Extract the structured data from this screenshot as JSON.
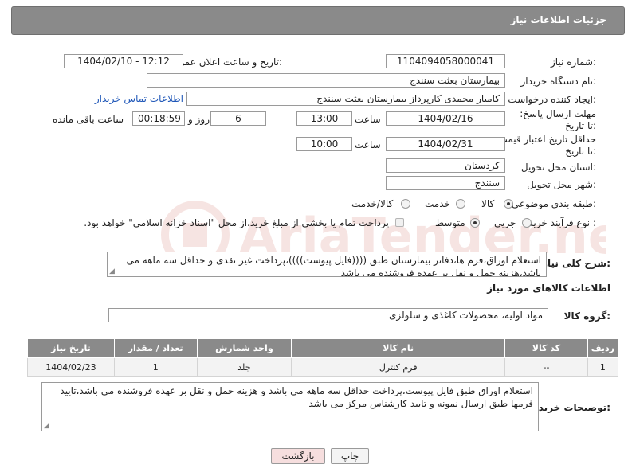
{
  "header": {
    "title": "جزئیات اطلاعات نیاز"
  },
  "fields": {
    "need_number_label": "شماره نیاز:",
    "need_number": "1104094058000041",
    "announce_label": "تاریخ و ساعت اعلان عمومی:",
    "announce_value": "1404/02/10 - 12:12",
    "buyer_org_label": "نام دستگاه خریدار:",
    "buyer_org": "بیمارستان بعثت سنندج",
    "requester_label": "ایجاد کننده درخواست:",
    "requester": "کامیار محمدی کارپرداز بیمارستان بعثت سنندج",
    "contact_link": "اطلاعات تماس خریدار",
    "deadline_label": "مهلت ارسال پاسخ: تا تاریخ:",
    "deadline_date": "1404/02/16",
    "time_label": "ساعت",
    "deadline_time": "13:00",
    "days_count": "6",
    "days_label": "روز و",
    "remaining_time": "00:18:59",
    "remaining_label": "ساعت باقی مانده",
    "validity_label": "حداقل تاریخ اعتبار قیمت: تا تاریخ:",
    "validity_date": "1404/02/31",
    "validity_time": "10:00",
    "province_label": "استان محل تحویل:",
    "province": "کردستان",
    "city_label": "شهر محل تحویل:",
    "city": "سنندج",
    "category_label": "طبقه بندی موضوعی:",
    "category_options": [
      "کالا",
      "خدمت",
      "کالا/خدمت"
    ],
    "category_selected": "کالا",
    "process_label": "نوع فرآیند خرید :",
    "process_options": [
      "جزیی",
      "متوسط"
    ],
    "process_selected": "متوسط",
    "payment_note": "پرداخت تمام یا بخشی از مبلغ خرید،از محل \"اسناد خزانه اسلامی\" خواهد بود."
  },
  "description": {
    "label": "شرح کلی نیاز:",
    "text": "استعلام اوراق،فرم ها،دفاتر بیمارستان طبق ((((فایل پیوست))))،پرداخت غیر نقدی و حداقل سه ماهه می باشد،هزینه حمل و نقل بر عهده فروشنده می باشد"
  },
  "goods": {
    "section_title": "اطلاعات کالاهای مورد نیاز",
    "group_label": "گروه کالا:",
    "group_value": "مواد اولیه، محصولات کاغذی و سلولزی",
    "columns": [
      "ردیف",
      "کد کالا",
      "نام کالا",
      "واحد شمارش",
      "تعداد / مقدار",
      "تاریخ نیاز"
    ],
    "rows": [
      {
        "row": "1",
        "code": "--",
        "name": "فرم کنترل",
        "unit": "جلد",
        "qty": "1",
        "date": "1404/02/23"
      }
    ]
  },
  "buyer_notes": {
    "label": "توضیحات خریدار:",
    "text": "استعلام اوراق طبق فایل پیوست،پرداخت حداقل سه ماهه می باشد و هزینه حمل و نقل بر عهده فروشنده می باشد،تایید فرمها طبق ارسال نمونه و تایید کارشناس مرکز می باشد"
  },
  "buttons": {
    "print": "چاپ",
    "back": "بازگشت"
  },
  "watermark": {
    "text": "AriaTender.net"
  },
  "colors": {
    "header_bg": "#8a8a8a",
    "link": "#1f57b8",
    "back_button_bg": "#f6dede",
    "watermark": "#c0392b"
  }
}
